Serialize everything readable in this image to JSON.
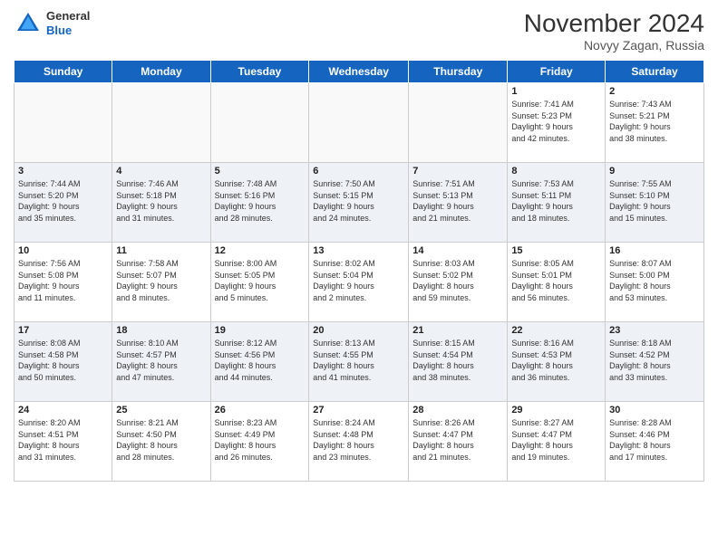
{
  "header": {
    "logo": {
      "general": "General",
      "blue": "Blue"
    },
    "title": "November 2024",
    "subtitle": "Novyy Zagan, Russia"
  },
  "weekdays": [
    "Sunday",
    "Monday",
    "Tuesday",
    "Wednesday",
    "Thursday",
    "Friday",
    "Saturday"
  ],
  "weeks": [
    [
      {
        "day": "",
        "info": ""
      },
      {
        "day": "",
        "info": ""
      },
      {
        "day": "",
        "info": ""
      },
      {
        "day": "",
        "info": ""
      },
      {
        "day": "",
        "info": ""
      },
      {
        "day": "1",
        "info": "Sunrise: 7:41 AM\nSunset: 5:23 PM\nDaylight: 9 hours\nand 42 minutes."
      },
      {
        "day": "2",
        "info": "Sunrise: 7:43 AM\nSunset: 5:21 PM\nDaylight: 9 hours\nand 38 minutes."
      }
    ],
    [
      {
        "day": "3",
        "info": "Sunrise: 7:44 AM\nSunset: 5:20 PM\nDaylight: 9 hours\nand 35 minutes."
      },
      {
        "day": "4",
        "info": "Sunrise: 7:46 AM\nSunset: 5:18 PM\nDaylight: 9 hours\nand 31 minutes."
      },
      {
        "day": "5",
        "info": "Sunrise: 7:48 AM\nSunset: 5:16 PM\nDaylight: 9 hours\nand 28 minutes."
      },
      {
        "day": "6",
        "info": "Sunrise: 7:50 AM\nSunset: 5:15 PM\nDaylight: 9 hours\nand 24 minutes."
      },
      {
        "day": "7",
        "info": "Sunrise: 7:51 AM\nSunset: 5:13 PM\nDaylight: 9 hours\nand 21 minutes."
      },
      {
        "day": "8",
        "info": "Sunrise: 7:53 AM\nSunset: 5:11 PM\nDaylight: 9 hours\nand 18 minutes."
      },
      {
        "day": "9",
        "info": "Sunrise: 7:55 AM\nSunset: 5:10 PM\nDaylight: 9 hours\nand 15 minutes."
      }
    ],
    [
      {
        "day": "10",
        "info": "Sunrise: 7:56 AM\nSunset: 5:08 PM\nDaylight: 9 hours\nand 11 minutes."
      },
      {
        "day": "11",
        "info": "Sunrise: 7:58 AM\nSunset: 5:07 PM\nDaylight: 9 hours\nand 8 minutes."
      },
      {
        "day": "12",
        "info": "Sunrise: 8:00 AM\nSunset: 5:05 PM\nDaylight: 9 hours\nand 5 minutes."
      },
      {
        "day": "13",
        "info": "Sunrise: 8:02 AM\nSunset: 5:04 PM\nDaylight: 9 hours\nand 2 minutes."
      },
      {
        "day": "14",
        "info": "Sunrise: 8:03 AM\nSunset: 5:02 PM\nDaylight: 8 hours\nand 59 minutes."
      },
      {
        "day": "15",
        "info": "Sunrise: 8:05 AM\nSunset: 5:01 PM\nDaylight: 8 hours\nand 56 minutes."
      },
      {
        "day": "16",
        "info": "Sunrise: 8:07 AM\nSunset: 5:00 PM\nDaylight: 8 hours\nand 53 minutes."
      }
    ],
    [
      {
        "day": "17",
        "info": "Sunrise: 8:08 AM\nSunset: 4:58 PM\nDaylight: 8 hours\nand 50 minutes."
      },
      {
        "day": "18",
        "info": "Sunrise: 8:10 AM\nSunset: 4:57 PM\nDaylight: 8 hours\nand 47 minutes."
      },
      {
        "day": "19",
        "info": "Sunrise: 8:12 AM\nSunset: 4:56 PM\nDaylight: 8 hours\nand 44 minutes."
      },
      {
        "day": "20",
        "info": "Sunrise: 8:13 AM\nSunset: 4:55 PM\nDaylight: 8 hours\nand 41 minutes."
      },
      {
        "day": "21",
        "info": "Sunrise: 8:15 AM\nSunset: 4:54 PM\nDaylight: 8 hours\nand 38 minutes."
      },
      {
        "day": "22",
        "info": "Sunrise: 8:16 AM\nSunset: 4:53 PM\nDaylight: 8 hours\nand 36 minutes."
      },
      {
        "day": "23",
        "info": "Sunrise: 8:18 AM\nSunset: 4:52 PM\nDaylight: 8 hours\nand 33 minutes."
      }
    ],
    [
      {
        "day": "24",
        "info": "Sunrise: 8:20 AM\nSunset: 4:51 PM\nDaylight: 8 hours\nand 31 minutes."
      },
      {
        "day": "25",
        "info": "Sunrise: 8:21 AM\nSunset: 4:50 PM\nDaylight: 8 hours\nand 28 minutes."
      },
      {
        "day": "26",
        "info": "Sunrise: 8:23 AM\nSunset: 4:49 PM\nDaylight: 8 hours\nand 26 minutes."
      },
      {
        "day": "27",
        "info": "Sunrise: 8:24 AM\nSunset: 4:48 PM\nDaylight: 8 hours\nand 23 minutes."
      },
      {
        "day": "28",
        "info": "Sunrise: 8:26 AM\nSunset: 4:47 PM\nDaylight: 8 hours\nand 21 minutes."
      },
      {
        "day": "29",
        "info": "Sunrise: 8:27 AM\nSunset: 4:47 PM\nDaylight: 8 hours\nand 19 minutes."
      },
      {
        "day": "30",
        "info": "Sunrise: 8:28 AM\nSunset: 4:46 PM\nDaylight: 8 hours\nand 17 minutes."
      }
    ]
  ]
}
